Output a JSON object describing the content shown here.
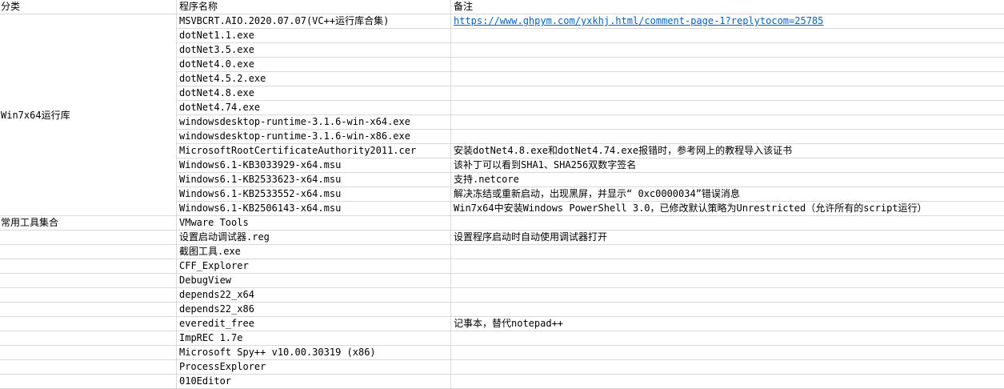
{
  "header": {
    "col1": "分类",
    "col2": "程序名称",
    "col3": "备注"
  },
  "groups": [
    {
      "label": "Win7x64运行库"
    },
    {
      "label": "常用工具集合"
    }
  ],
  "rows": [
    {
      "name": "MSVBCRT.AIO.2020.07.07(VC++运行库合集)",
      "note": "https://www.ghpym.com/yxkhj.html/comment-page-1?replytocom=25785"
    },
    {
      "name": "dotNet1.1.exe",
      "note": ""
    },
    {
      "name": "dotNet3.5.exe",
      "note": ""
    },
    {
      "name": "dotNet4.0.exe",
      "note": ""
    },
    {
      "name": "dotNet4.5.2.exe",
      "note": ""
    },
    {
      "name": "dotNet4.8.exe",
      "note": ""
    },
    {
      "name": "dotNet4.74.exe",
      "note": ""
    },
    {
      "name": "windowsdesktop-runtime-3.1.6-win-x64.exe",
      "note": ""
    },
    {
      "name": "windowsdesktop-runtime-3.1.6-win-x86.exe",
      "note": ""
    },
    {
      "name": "MicrosoftRootCertificateAuthority2011.cer",
      "note": "安装dotNet4.8.exe和dotNet4.74.exe报错时，参考网上的教程导入该证书"
    },
    {
      "name": "Windows6.1-KB3033929-x64.msu",
      "note": "该补丁可以看到SHA1、SHA256双数字签名"
    },
    {
      "name": "Windows6.1-KB2533623-x64.msu",
      "note": "支持.netcore"
    },
    {
      "name": "Windows6.1-KB2533552-x64.msu",
      "note": "解决冻结或重新启动，出现黑屏，并显示“ 0xc0000034”错误消息"
    },
    {
      "name": "Windows6.1-KB2506143-x64.msu",
      "note": "Win7x64中安装Windows PowerShell 3.0，已修改默认策略为Unrestricted（允许所有的script运行）"
    },
    {
      "name": "VMware Tools",
      "note": ""
    },
    {
      "name": "设置启动调试器.reg",
      "note": "设置程序启动时自动使用调试器打开"
    },
    {
      "name": "截图工具.exe",
      "note": ""
    },
    {
      "name": "CFF_Explorer",
      "note": ""
    },
    {
      "name": "DebugView",
      "note": ""
    },
    {
      "name": "depends22_x64",
      "note": ""
    },
    {
      "name": "depends22_x86",
      "note": ""
    },
    {
      "name": "everedit_free",
      "note": "记事本，替代notepad++"
    },
    {
      "name": "ImpREC 1.7e",
      "note": ""
    },
    {
      "name": "Microsoft Spy++ v10.00.30319 (x86)",
      "note": ""
    },
    {
      "name": "ProcessExplorer",
      "note": ""
    },
    {
      "name": "010Editor",
      "note": ""
    }
  ]
}
